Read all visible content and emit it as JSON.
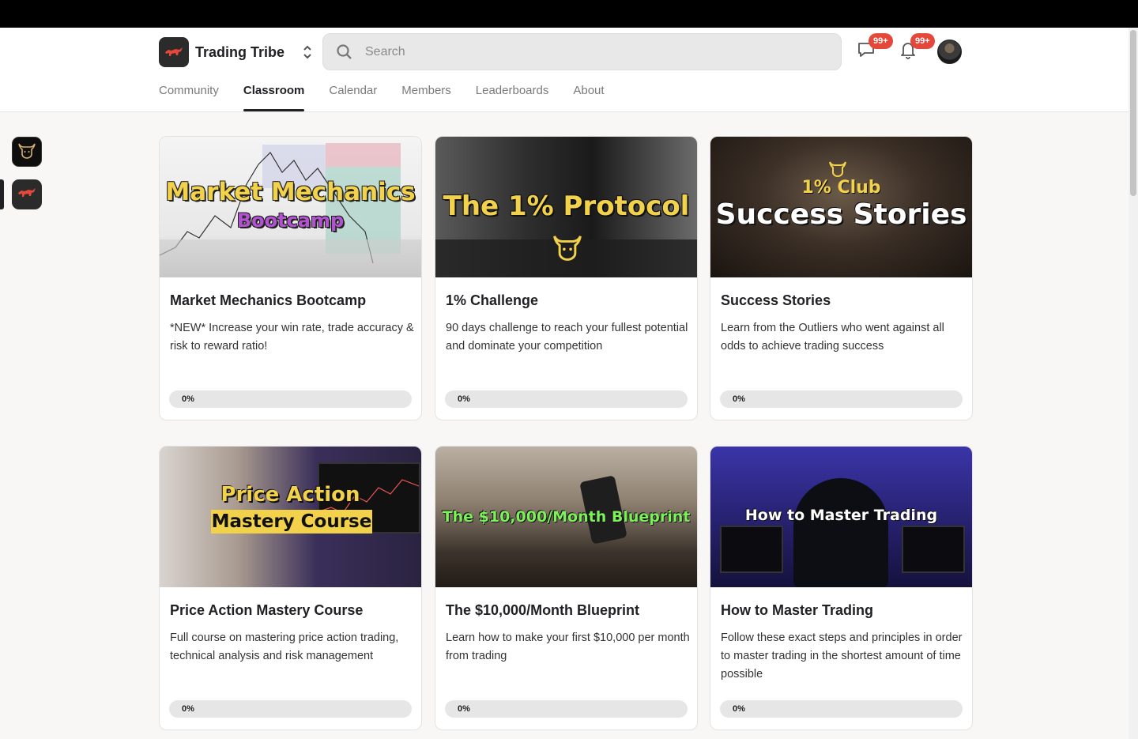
{
  "app": {
    "name": "Trading Tribe"
  },
  "search": {
    "placeholder": "Search"
  },
  "header": {
    "chat_badge": "99+",
    "notifications_badge": "99+"
  },
  "nav": {
    "tabs": [
      {
        "label": "Community"
      },
      {
        "label": "Classroom"
      },
      {
        "label": "Calendar"
      },
      {
        "label": "Members"
      },
      {
        "label": "Leaderboards"
      },
      {
        "label": "About"
      }
    ],
    "active": "Classroom"
  },
  "courses": [
    {
      "thumb_line1": "Market Mechanics",
      "thumb_line2": "Bootcamp",
      "title": "Market Mechanics Bootcamp",
      "description": "*NEW* Increase your win rate, trade accuracy & risk to reward ratio!",
      "progress": "0%"
    },
    {
      "thumb_line1": "The 1% Protocol",
      "title": "1% Challenge",
      "description": "90 days challenge to reach your fullest potential and dominate your competition",
      "progress": "0%"
    },
    {
      "thumb_line1": "1% Club",
      "thumb_line2": "Success Stories",
      "title": "Success Stories",
      "description": "Learn from the Outliers who went against all odds to achieve trading success",
      "progress": "0%"
    },
    {
      "thumb_line1": "Price Action",
      "thumb_line2": "Mastery Course",
      "title": "Price Action Mastery Course",
      "description": "Full course on mastering price action trading, technical analysis and risk management",
      "progress": "0%"
    },
    {
      "thumb_line1": "The  $10,000/Month Blueprint",
      "title": "The $10,000/Month Blueprint",
      "description": "Learn how to make your first $10,000 per month from trading",
      "progress": "0%"
    },
    {
      "thumb_line1": "How to Master Trading",
      "title": "How to Master Trading",
      "description": "Follow these exact steps and principles in order to master trading in the shortest amount of time possible",
      "progress": "0%"
    }
  ],
  "colors": {
    "badge": "#e5483a",
    "brand_bull": "#e5483a",
    "active_tab": "#202124"
  }
}
